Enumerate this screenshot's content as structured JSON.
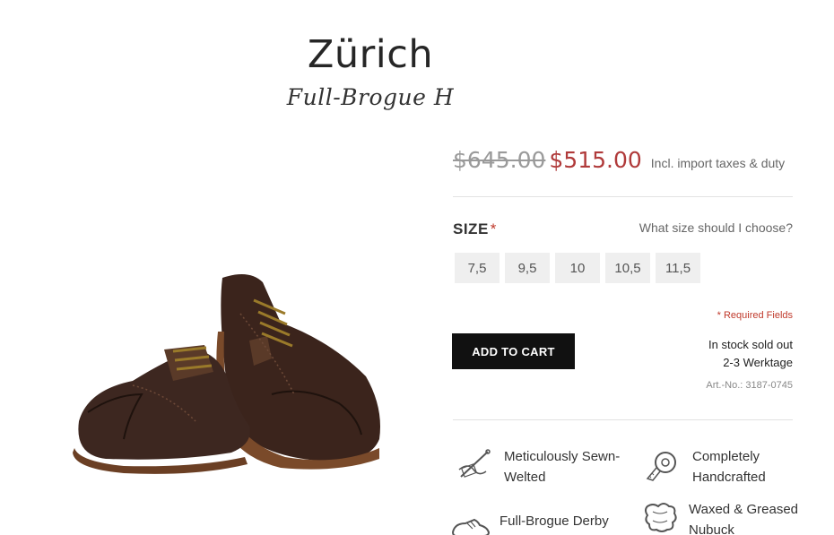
{
  "product": {
    "title": "Zürich",
    "subtitle": "Full-Brogue H"
  },
  "pricing": {
    "old_price": "$645.00",
    "new_price": "$515.00",
    "tax_note": "Incl. import taxes & duty"
  },
  "size": {
    "label": "SIZE",
    "required_mark": "*",
    "help_link": "What size should I choose?",
    "options": [
      "7,5",
      "9,5",
      "10",
      "10,5",
      "11,5"
    ]
  },
  "form": {
    "required_fields": "* Required Fields"
  },
  "cart": {
    "add_label": "ADD TO CART"
  },
  "availability": {
    "stock": "In stock sold out",
    "delivery": "2-3 Werktage",
    "article_no": "Art.-No.: 3187-0745"
  },
  "features": [
    {
      "icon": "needle-thread-icon",
      "line1": "Meticulously Sewn-",
      "line2": "Welted"
    },
    {
      "icon": "measuring-tape-icon",
      "line1": "Completely",
      "line2": "Handcrafted"
    },
    {
      "icon": "shoe-icon",
      "line1": "Full-Brogue Derby",
      "line2": ""
    },
    {
      "icon": "leather-hide-icon",
      "line1": "Waxed & Greased",
      "line2": "Nubuck"
    }
  ],
  "colors": {
    "accent_red": "#b03a3a",
    "button_black": "#111111",
    "size_button_bg": "#efefef"
  }
}
